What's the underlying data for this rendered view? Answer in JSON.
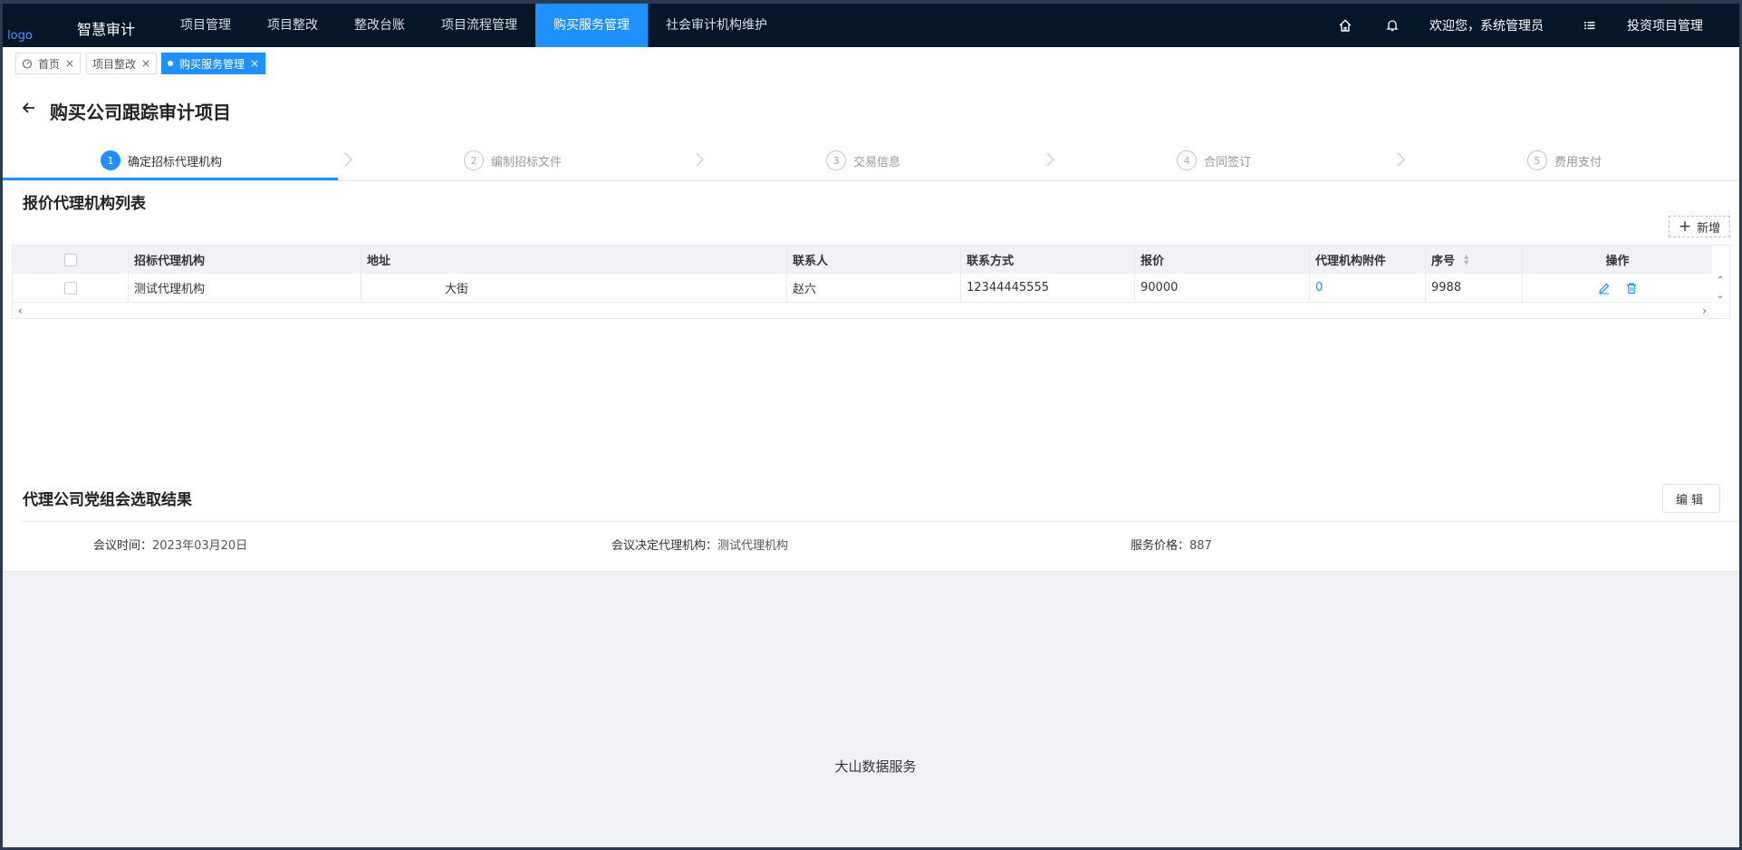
{
  "nav": {
    "logo": "logo",
    "app_title": "智慧审计",
    "items": [
      {
        "label": "项目管理",
        "active": false
      },
      {
        "label": "项目整改",
        "active": false
      },
      {
        "label": "整改台账",
        "active": false
      },
      {
        "label": "项目流程管理",
        "active": false
      },
      {
        "label": "购买服务管理",
        "active": true
      },
      {
        "label": "社会审计机构维护",
        "active": false
      }
    ],
    "welcome": "欢迎您，系统管理员",
    "project": "投资项目管理",
    "icons": [
      "home-icon",
      "bell-icon",
      "list-icon"
    ]
  },
  "tabs": [
    {
      "label": "首页",
      "icon": "dashboard-icon",
      "active": false
    },
    {
      "label": "项目整改",
      "active": false
    },
    {
      "label": "购买服务管理",
      "active": true
    }
  ],
  "page": {
    "title": "购买公司跟踪审计项目"
  },
  "steps": [
    {
      "num": "1",
      "label": "确定招标代理机构",
      "active": true
    },
    {
      "num": "2",
      "label": "编制招标文件",
      "active": false
    },
    {
      "num": "3",
      "label": "交易信息",
      "active": false
    },
    {
      "num": "4",
      "label": "合同签订",
      "active": false
    },
    {
      "num": "5",
      "label": "费用支付",
      "active": false
    }
  ],
  "agency_list": {
    "title": "报价代理机构列表",
    "add_label": "新增",
    "columns": [
      "招标代理机构",
      "地址",
      "联系人",
      "联系方式",
      "报价",
      "代理机构附件",
      "序号",
      "操作"
    ],
    "rows": [
      {
        "agency": "测试代理机构",
        "address": "大街",
        "contact": "赵六",
        "phone": "12344445555",
        "quote": "90000",
        "attachments": "0",
        "seq": "9988"
      }
    ]
  },
  "selection": {
    "title": "代理公司党组会选取结果",
    "edit_label": "编辑",
    "meeting_time_label": "会议时间：",
    "meeting_time": "2023年03月20日",
    "decided_agency_label": "会议决定代理机构：",
    "decided_agency": "测试代理机构",
    "price_label": "服务价格：",
    "price": "887"
  },
  "footer": {
    "text": "大山数据服务"
  },
  "colors": {
    "nav_bg": "#041628",
    "accent": "#1e90ff",
    "footer_bg": "#f0f2f5"
  }
}
